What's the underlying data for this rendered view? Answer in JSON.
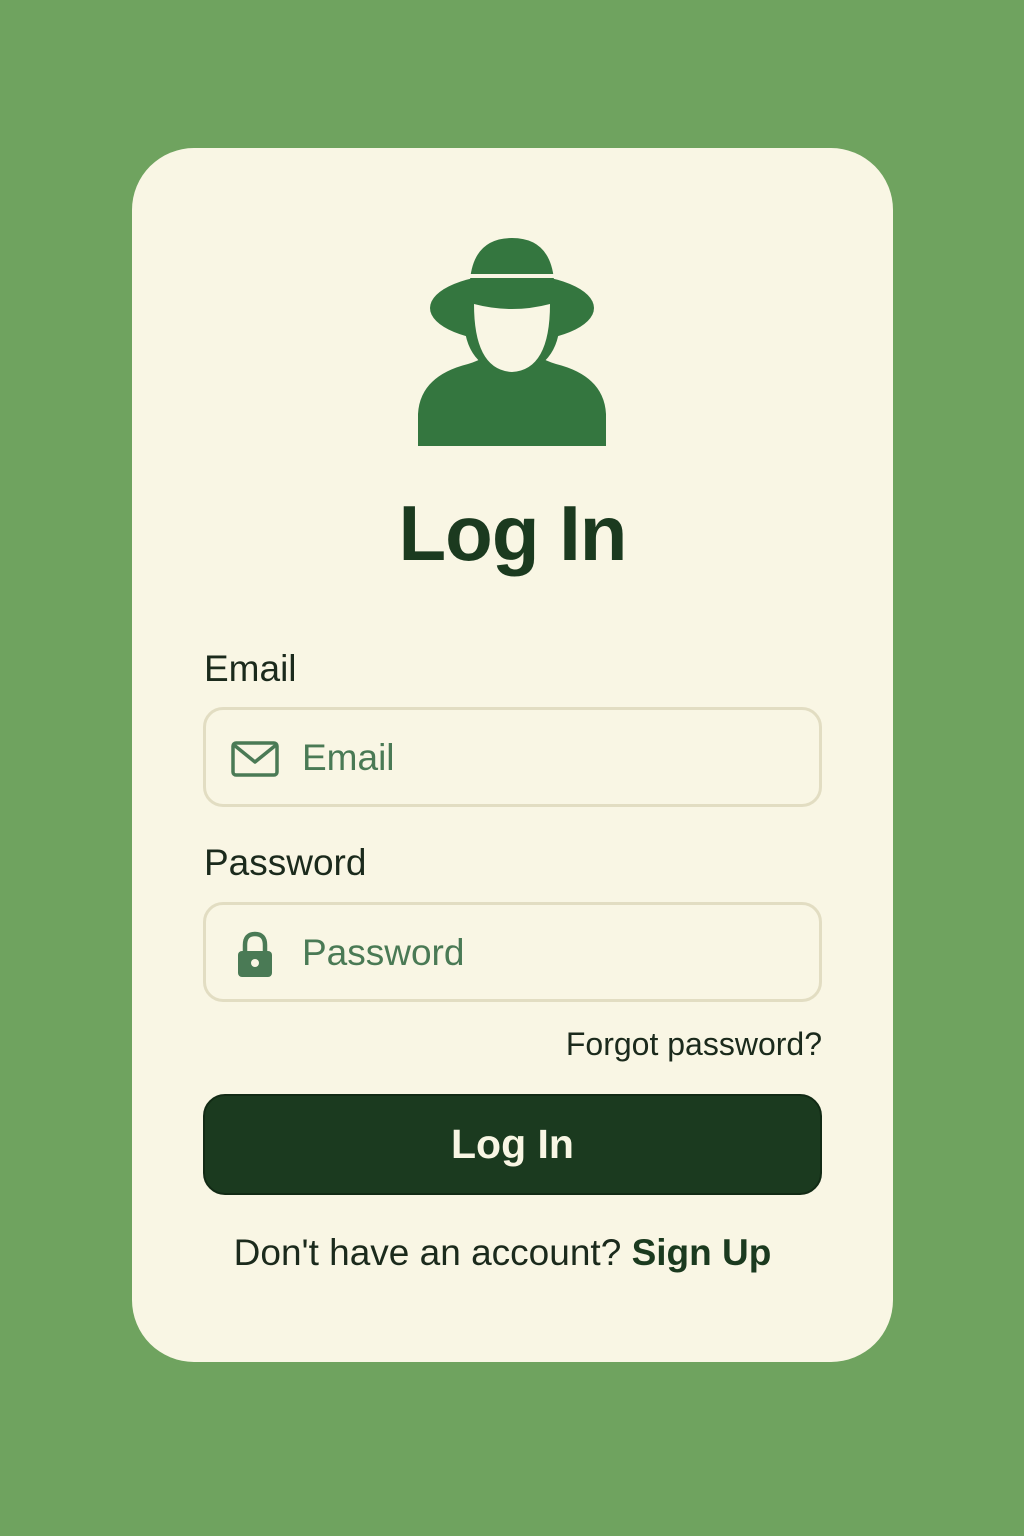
{
  "login": {
    "title": "Log In",
    "email_label": "Email",
    "email_placeholder": "Email",
    "email_value": "",
    "password_label": "Password",
    "password_placeholder": "Password",
    "password_value": "",
    "forgot_label": "Forgot password?",
    "button_label": "Log In",
    "signup_prompt": "Don't have an account?",
    "signup_link": "Sign Up"
  },
  "icons": {
    "avatar": "user-with-hat-icon",
    "email": "envelope-icon",
    "password": "lock-icon"
  },
  "colors": {
    "background": "#6fa35f",
    "card": "#f9f6e4",
    "primary": "#1b3a1f",
    "avatar": "#34763f"
  }
}
